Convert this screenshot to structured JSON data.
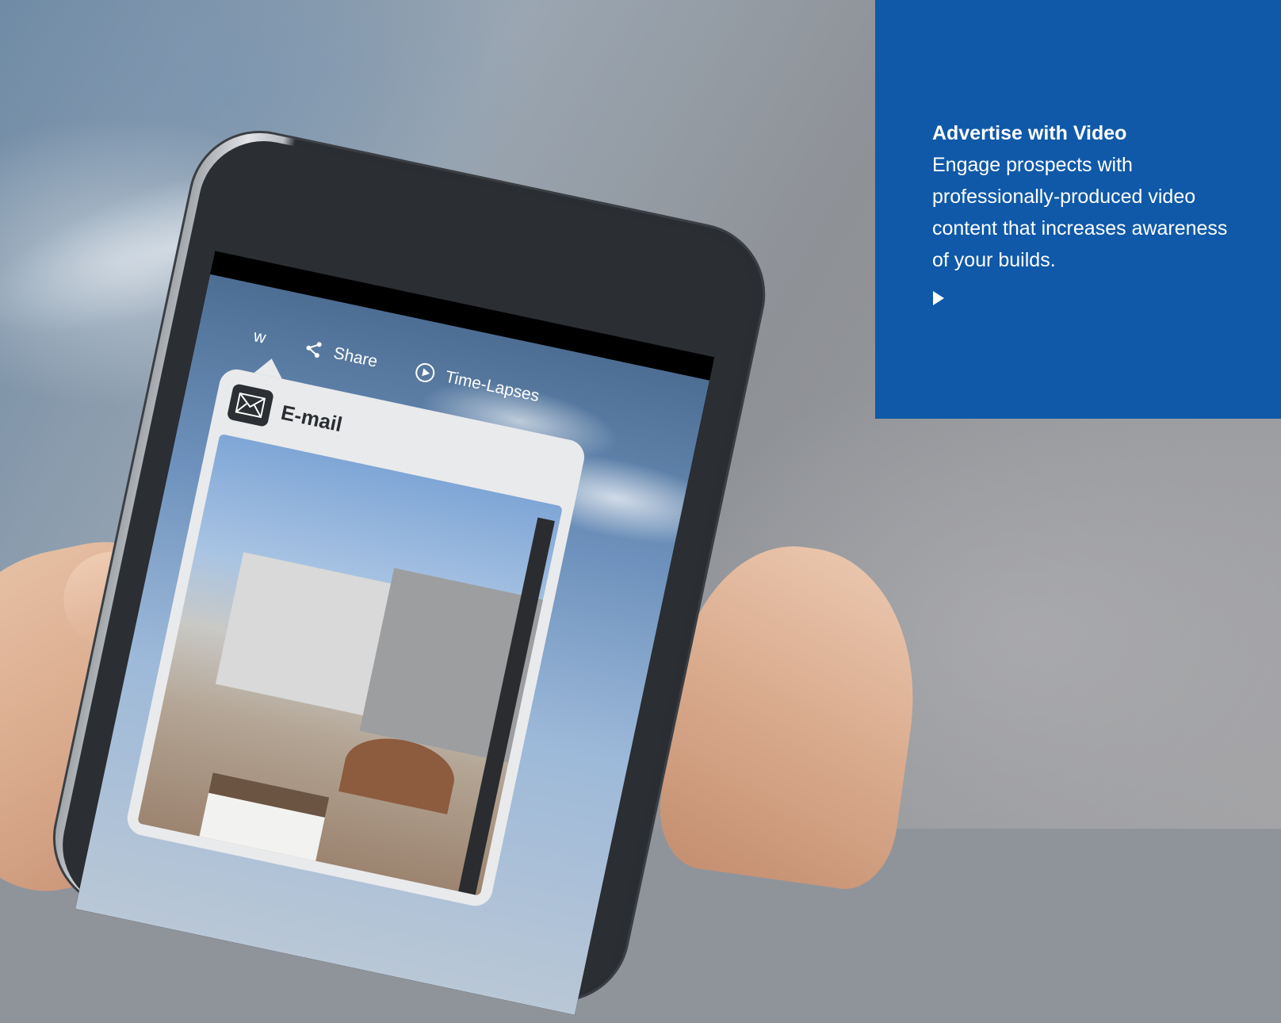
{
  "panel": {
    "title": "Advertise with Video",
    "body": "Engage prospects with professionally-produced video content that increases awareness of your builds.",
    "background_color": "#1059a8",
    "play_icon": "play-icon"
  },
  "phone_screen": {
    "toolbar": {
      "partial_label": "w",
      "share_label": "Share",
      "timelapses_label": "Time-Lapses"
    },
    "popover": {
      "title": "E-mail",
      "icon": "envelope-icon"
    }
  }
}
